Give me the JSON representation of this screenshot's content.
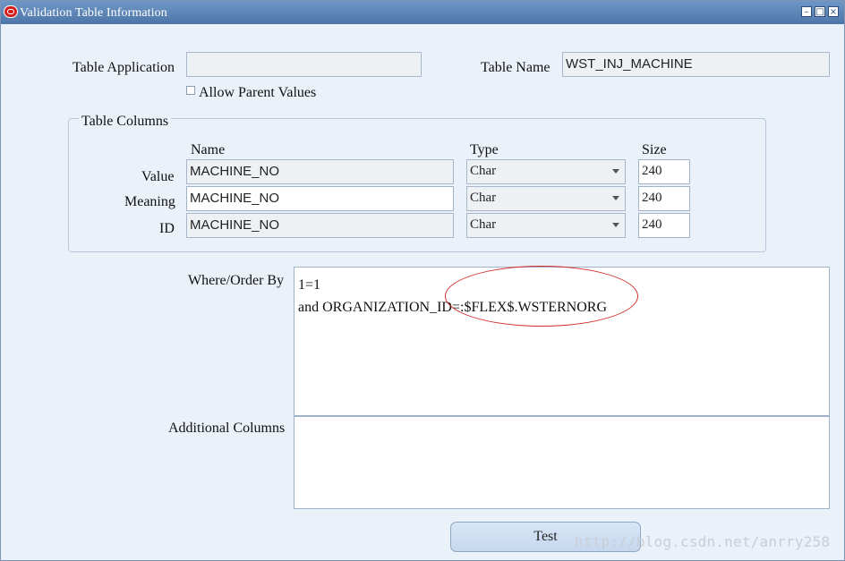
{
  "window": {
    "title": "Validation Table Information",
    "controls": [
      "minimize-icon",
      "maximize-icon",
      "close-icon"
    ]
  },
  "form": {
    "table_application": {
      "label": "Table Application",
      "value": ""
    },
    "table_name": {
      "label": "Table Name",
      "value": "WST_INJ_MACHINE"
    },
    "allow_parent_values": {
      "label": "Allow Parent Values",
      "checked": false
    }
  },
  "table_columns": {
    "group_title": "Table Columns",
    "headers": {
      "name": "Name",
      "type": "Type",
      "size": "Size"
    },
    "rows": [
      {
        "label": "Value",
        "name": "MACHINE_NO",
        "type": "Char",
        "size": "240"
      },
      {
        "label": "Meaning",
        "name": "MACHINE_NO",
        "type": "Char",
        "size": "240"
      },
      {
        "label": "ID",
        "name": "MACHINE_NO",
        "type": "Char",
        "size": "240"
      }
    ]
  },
  "where_order_by": {
    "label": "Where/Order By",
    "lines": [
      "1=1",
      "and ORGANIZATION_ID=:$FLEX$.WSTERNORG"
    ]
  },
  "additional_columns": {
    "label": "Additional Columns",
    "value": ""
  },
  "buttons": {
    "test": "Test"
  },
  "watermark": "http://blog.csdn.net/anrry258",
  "colors": {
    "titlebar": "#5a82b4",
    "annotation": "#d02a2a",
    "background": "#eaf1f8"
  }
}
